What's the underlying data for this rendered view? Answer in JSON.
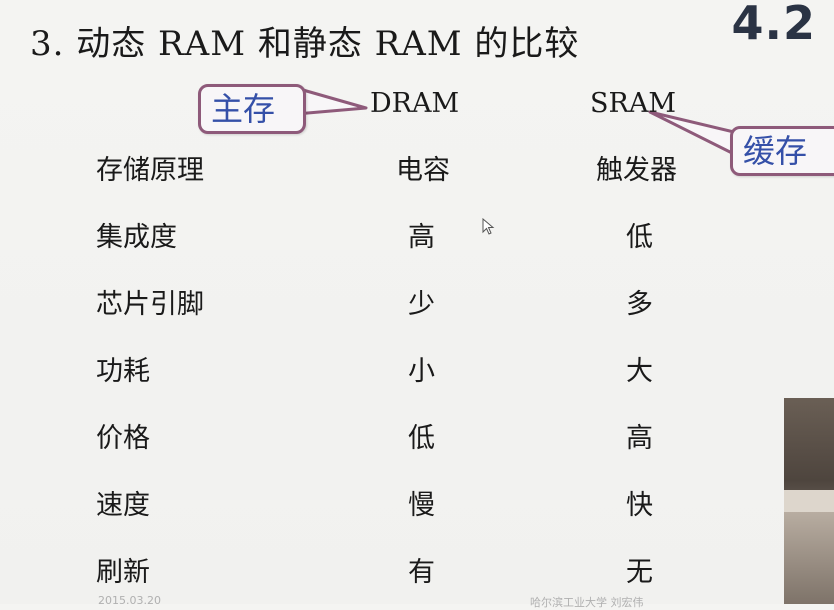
{
  "slide": {
    "title": "3. 动态 RAM 和静态 RAM 的比较",
    "section_number": "4.2"
  },
  "columns": {
    "dram": "DRAM",
    "sram": "SRAM"
  },
  "callouts": {
    "main_memory": "主存",
    "cache": "缓存"
  },
  "rows": [
    {
      "property": "存储原理",
      "dram": "电容",
      "sram": "触发器"
    },
    {
      "property": "集成度",
      "dram": "高",
      "sram": "低"
    },
    {
      "property": "芯片引脚",
      "dram": "少",
      "sram": "多"
    },
    {
      "property": "功耗",
      "dram": "小",
      "sram": "大"
    },
    {
      "property": "价格",
      "dram": "低",
      "sram": "高"
    },
    {
      "property": "速度",
      "dram": "慢",
      "sram": "快"
    },
    {
      "property": "刷新",
      "dram": "有",
      "sram": "无"
    }
  ],
  "footer": {
    "date": "2015.03.20",
    "org": "哈尔滨工业大学 刘宏伟"
  },
  "colors": {
    "callout_border": "#8e5a7a",
    "callout_text": "#3550a8",
    "section_number": "#2a3344"
  }
}
